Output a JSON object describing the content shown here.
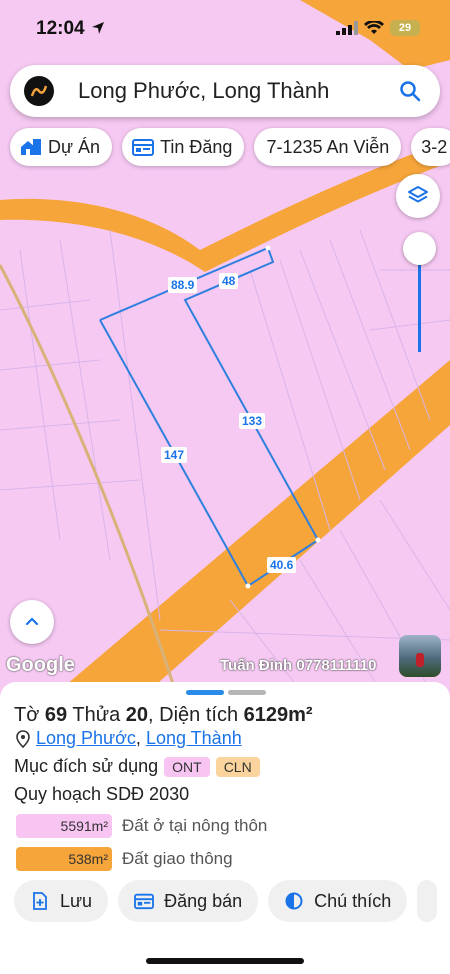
{
  "status": {
    "time": "12:04",
    "battery": "29"
  },
  "search": {
    "text": "Long Phước, Long Thành"
  },
  "chips": [
    {
      "label": "Dự Án",
      "icon": "house-building-icon"
    },
    {
      "label": "Tin Đăng",
      "icon": "listing-icon"
    },
    {
      "label": "7-1235 An Viễn",
      "icon": ""
    },
    {
      "label": "3-2",
      "icon": ""
    }
  ],
  "map": {
    "plot_labels": {
      "top_left": "88.9",
      "top_right": "48",
      "right": "133",
      "left": "147",
      "bottom": "40.6"
    },
    "google": "Google",
    "owner": "Tuấn Đinh 0778111110",
    "colors": {
      "land": "#f6c9f3",
      "road": "#f5a53a",
      "boundary": "#2f7fde"
    }
  },
  "sheet": {
    "title_prefix": "Tờ",
    "sheet_no": "69",
    "parcel_prefix": "Thửa",
    "parcel_no": "20",
    "area_prefix": ", Diện tích",
    "area": "6129m²",
    "ward": "Long Phước",
    "district": "Long Thành",
    "separator": ",",
    "purpose_label": "Mục đích sử dụng",
    "tags": [
      "ONT",
      "CLN"
    ],
    "plan_title": "Quy hoạch SDĐ 2030",
    "legend": [
      {
        "value": "5591m²",
        "label": "Đất ở tại nông thôn",
        "color": "#f8c5f3"
      },
      {
        "value": "538m²",
        "label": "Đất giao thông",
        "color": "#f5a53a"
      }
    ],
    "actions": [
      {
        "label": "Lưu",
        "icon": "save-icon"
      },
      {
        "label": "Đăng bán",
        "icon": "listing-icon"
      },
      {
        "label": "Chú thích",
        "icon": "contrast-icon"
      }
    ]
  }
}
